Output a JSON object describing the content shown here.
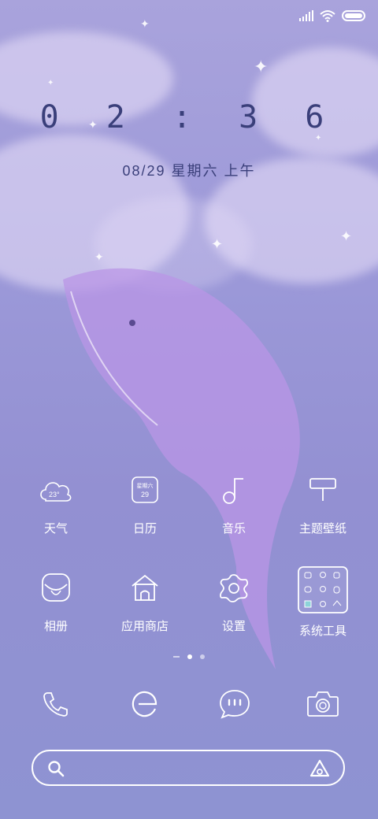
{
  "clock": {
    "time": "0 2 : 3 6",
    "date": "08/29 星期六 上午"
  },
  "weather_icon": {
    "temp": "23°"
  },
  "calendar_icon": {
    "weekday": "星期六",
    "day": "29"
  },
  "apps": [
    {
      "label": "天气",
      "icon": "cloud-icon"
    },
    {
      "label": "日历",
      "icon": "calendar-icon"
    },
    {
      "label": "音乐",
      "icon": "music-note-icon"
    },
    {
      "label": "主题壁纸",
      "icon": "theme-brush-icon"
    },
    {
      "label": "相册",
      "icon": "gallery-icon"
    },
    {
      "label": "应用商店",
      "icon": "store-house-icon"
    },
    {
      "label": "设置",
      "icon": "gear-icon"
    },
    {
      "label": "系统工具",
      "icon": "folder-grid-icon"
    }
  ],
  "dock": [
    {
      "icon": "phone-icon"
    },
    {
      "icon": "browser-icon"
    },
    {
      "icon": "messages-icon"
    },
    {
      "icon": "camera-icon"
    }
  ],
  "search": {
    "icon": "search-icon",
    "assistant_icon": "assistant-icon"
  },
  "page_indicator": {
    "pages": 2,
    "current": 1
  },
  "colors": {
    "clock_text": "#3a3f7a",
    "background_top": "#a9a3dc",
    "background_bottom": "#8e93d2"
  }
}
